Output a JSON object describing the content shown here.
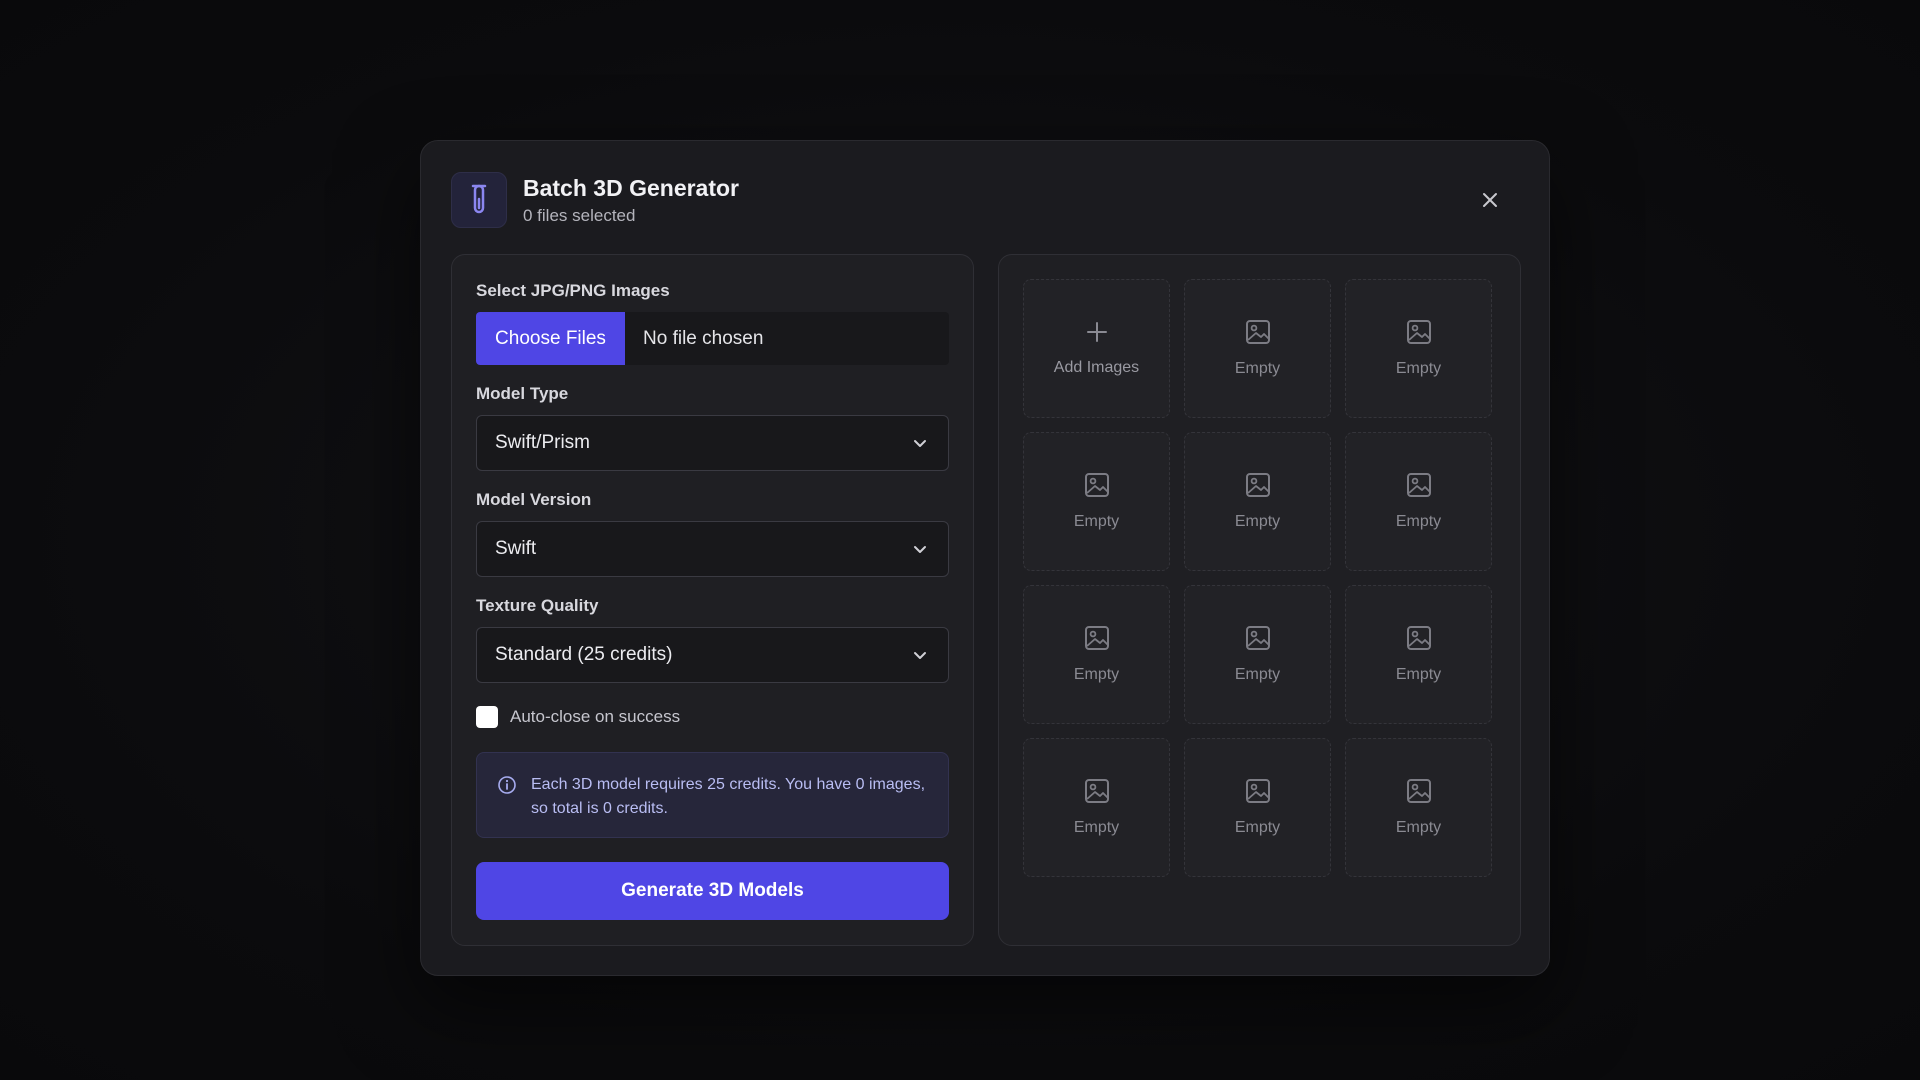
{
  "header": {
    "title": "Batch 3D Generator",
    "subtitle": "0 files selected",
    "icon": "test-tube-icon"
  },
  "form": {
    "images_label": "Select JPG/PNG Images",
    "choose_files_label": "Choose Files",
    "no_file_label": "No file chosen",
    "model_type_label": "Model Type",
    "model_type_value": "Swift/Prism",
    "model_version_label": "Model Version",
    "model_version_value": "Swift",
    "texture_quality_label": "Texture Quality",
    "texture_quality_value": "Standard (25 credits)",
    "auto_close_label": "Auto-close on success",
    "auto_close_checked": false,
    "info_text": "Each 3D model requires 25 credits. You have 0 images, so total is 0 credits.",
    "generate_label": "Generate 3D Models"
  },
  "grid": {
    "add_label": "Add Images",
    "empty_label": "Empty",
    "slot_count": 12
  },
  "colors": {
    "accent": "#4f46e5",
    "info_bg": "#26263a",
    "info_text": "#b9bdf3"
  }
}
